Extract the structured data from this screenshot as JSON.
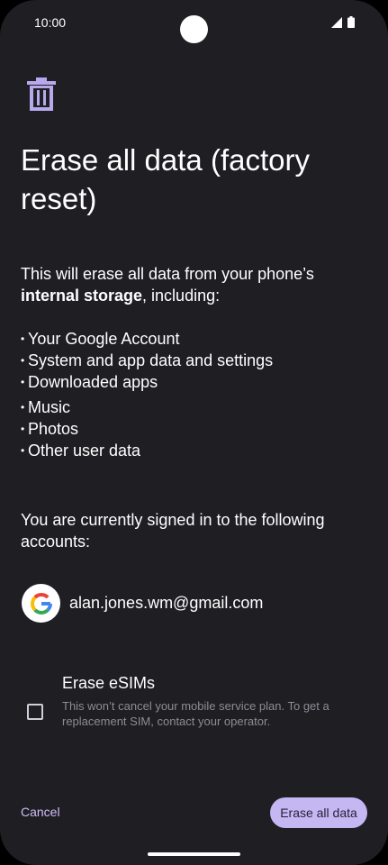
{
  "status_bar": {
    "time": "10:00"
  },
  "header": {
    "icon": "trash-icon",
    "title": "Erase all data (factory reset)"
  },
  "intro": {
    "before": "This will erase all data from your phone’s ",
    "bold": "internal storage",
    "after": ", including:"
  },
  "bullets": [
    "Your Google Account",
    "System and app data and settings",
    "Downloaded apps",
    "Music",
    "Photos",
    "Other user data"
  ],
  "signed_in_text": "You are currently signed in to the following accounts:",
  "account": {
    "email": "alan.jones.wm@gmail.com",
    "icon": "google-logo-icon"
  },
  "esim": {
    "title": "Erase eSIMs",
    "description": "This won’t cancel your mobile service plan. To get a replacement SIM, contact your operator.",
    "checked": false
  },
  "actions": {
    "cancel_label": "Cancel",
    "erase_label": "Erase all data"
  },
  "colors": {
    "background": "#1f1e23",
    "accent": "#c5b7f1",
    "accent_text": "#cdbef5"
  }
}
